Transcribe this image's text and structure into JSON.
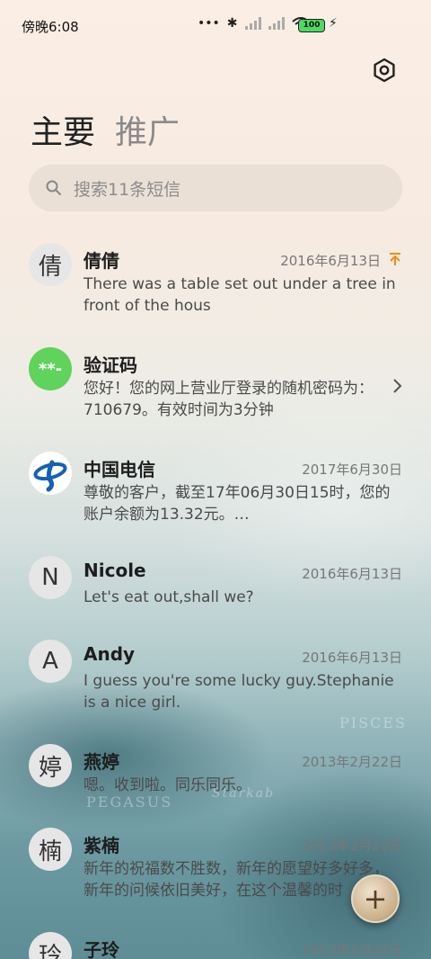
{
  "status_bar": {
    "time": "傍晚6:08",
    "battery": "100",
    "icons": [
      "dots-icon",
      "bluetooth-icon",
      "signal-icon",
      "signal-icon",
      "wifi-icon",
      "battery-icon",
      "charging-icon"
    ]
  },
  "header": {
    "tab_main": "主要",
    "tab_promo": "推广",
    "settings_icon": "gear-icon"
  },
  "search": {
    "placeholder": "搜索11条短信"
  },
  "conversations": [
    {
      "avatar": "倩",
      "name": "倩倩",
      "date": "2016年6月13日",
      "preview": "There was a table set out under a tree in front of the hous",
      "pinned": true
    },
    {
      "avatar": "**-",
      "name": "验证码",
      "date": "",
      "preview": "您好！您的网上营业厅登录的随机密码为：710679。有效时间为3分钟",
      "avatar_color": "#5fd35c"
    },
    {
      "avatar": "",
      "name": "中国电信",
      "date": "2017年6月30日",
      "preview": "尊敬的客户，截至17年06月30日15时，您的账户余额为13.32元。…"
    },
    {
      "avatar": "N",
      "name": "Nicole",
      "date": "2016年6月13日",
      "preview": "Let's eat out,shall we?"
    },
    {
      "avatar": "A",
      "name": "Andy",
      "date": "2016年6月13日",
      "preview": "I guess you're some lucky guy.Stephanie is a nice girl."
    },
    {
      "avatar": "婷",
      "name": "燕婷",
      "date": "2013年2月22日",
      "preview": "嗯。收到啦。同乐同乐。"
    },
    {
      "avatar": "楠",
      "name": "紫楠",
      "date": "2013年2月22日",
      "preview": "新年的祝福数不胜数，新年的愿望好多好多，新年的问候依旧美好，在这个温馨的时"
    },
    {
      "avatar": "玲",
      "name": "子玲",
      "date": "2013年2月22日",
      "preview": ""
    }
  ],
  "fab": {
    "label": "+"
  },
  "background_words": [
    "PISCES",
    "PEGASUS",
    "Starkab"
  ]
}
